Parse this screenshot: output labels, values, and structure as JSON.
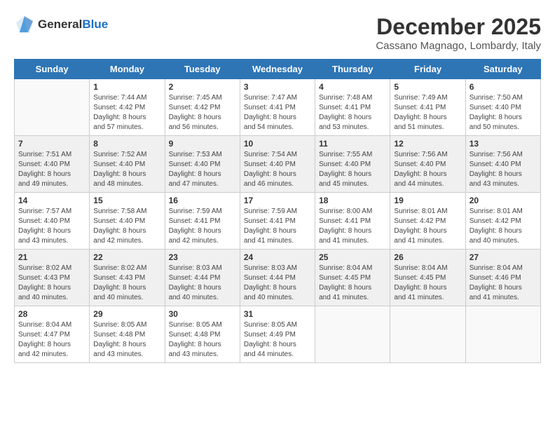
{
  "logo": {
    "general": "General",
    "blue": "Blue"
  },
  "title": "December 2025",
  "location": "Cassano Magnago, Lombardy, Italy",
  "headers": [
    "Sunday",
    "Monday",
    "Tuesday",
    "Wednesday",
    "Thursday",
    "Friday",
    "Saturday"
  ],
  "weeks": [
    [
      {
        "day": "",
        "info": ""
      },
      {
        "day": "1",
        "info": "Sunrise: 7:44 AM\nSunset: 4:42 PM\nDaylight: 8 hours\nand 57 minutes."
      },
      {
        "day": "2",
        "info": "Sunrise: 7:45 AM\nSunset: 4:42 PM\nDaylight: 8 hours\nand 56 minutes."
      },
      {
        "day": "3",
        "info": "Sunrise: 7:47 AM\nSunset: 4:41 PM\nDaylight: 8 hours\nand 54 minutes."
      },
      {
        "day": "4",
        "info": "Sunrise: 7:48 AM\nSunset: 4:41 PM\nDaylight: 8 hours\nand 53 minutes."
      },
      {
        "day": "5",
        "info": "Sunrise: 7:49 AM\nSunset: 4:41 PM\nDaylight: 8 hours\nand 51 minutes."
      },
      {
        "day": "6",
        "info": "Sunrise: 7:50 AM\nSunset: 4:40 PM\nDaylight: 8 hours\nand 50 minutes."
      }
    ],
    [
      {
        "day": "7",
        "info": "Sunrise: 7:51 AM\nSunset: 4:40 PM\nDaylight: 8 hours\nand 49 minutes."
      },
      {
        "day": "8",
        "info": "Sunrise: 7:52 AM\nSunset: 4:40 PM\nDaylight: 8 hours\nand 48 minutes."
      },
      {
        "day": "9",
        "info": "Sunrise: 7:53 AM\nSunset: 4:40 PM\nDaylight: 8 hours\nand 47 minutes."
      },
      {
        "day": "10",
        "info": "Sunrise: 7:54 AM\nSunset: 4:40 PM\nDaylight: 8 hours\nand 46 minutes."
      },
      {
        "day": "11",
        "info": "Sunrise: 7:55 AM\nSunset: 4:40 PM\nDaylight: 8 hours\nand 45 minutes."
      },
      {
        "day": "12",
        "info": "Sunrise: 7:56 AM\nSunset: 4:40 PM\nDaylight: 8 hours\nand 44 minutes."
      },
      {
        "day": "13",
        "info": "Sunrise: 7:56 AM\nSunset: 4:40 PM\nDaylight: 8 hours\nand 43 minutes."
      }
    ],
    [
      {
        "day": "14",
        "info": "Sunrise: 7:57 AM\nSunset: 4:40 PM\nDaylight: 8 hours\nand 43 minutes."
      },
      {
        "day": "15",
        "info": "Sunrise: 7:58 AM\nSunset: 4:40 PM\nDaylight: 8 hours\nand 42 minutes."
      },
      {
        "day": "16",
        "info": "Sunrise: 7:59 AM\nSunset: 4:41 PM\nDaylight: 8 hours\nand 42 minutes."
      },
      {
        "day": "17",
        "info": "Sunrise: 7:59 AM\nSunset: 4:41 PM\nDaylight: 8 hours\nand 41 minutes."
      },
      {
        "day": "18",
        "info": "Sunrise: 8:00 AM\nSunset: 4:41 PM\nDaylight: 8 hours\nand 41 minutes."
      },
      {
        "day": "19",
        "info": "Sunrise: 8:01 AM\nSunset: 4:42 PM\nDaylight: 8 hours\nand 41 minutes."
      },
      {
        "day": "20",
        "info": "Sunrise: 8:01 AM\nSunset: 4:42 PM\nDaylight: 8 hours\nand 40 minutes."
      }
    ],
    [
      {
        "day": "21",
        "info": "Sunrise: 8:02 AM\nSunset: 4:43 PM\nDaylight: 8 hours\nand 40 minutes."
      },
      {
        "day": "22",
        "info": "Sunrise: 8:02 AM\nSunset: 4:43 PM\nDaylight: 8 hours\nand 40 minutes."
      },
      {
        "day": "23",
        "info": "Sunrise: 8:03 AM\nSunset: 4:44 PM\nDaylight: 8 hours\nand 40 minutes."
      },
      {
        "day": "24",
        "info": "Sunrise: 8:03 AM\nSunset: 4:44 PM\nDaylight: 8 hours\nand 40 minutes."
      },
      {
        "day": "25",
        "info": "Sunrise: 8:04 AM\nSunset: 4:45 PM\nDaylight: 8 hours\nand 41 minutes."
      },
      {
        "day": "26",
        "info": "Sunrise: 8:04 AM\nSunset: 4:45 PM\nDaylight: 8 hours\nand 41 minutes."
      },
      {
        "day": "27",
        "info": "Sunrise: 8:04 AM\nSunset: 4:46 PM\nDaylight: 8 hours\nand 41 minutes."
      }
    ],
    [
      {
        "day": "28",
        "info": "Sunrise: 8:04 AM\nSunset: 4:47 PM\nDaylight: 8 hours\nand 42 minutes."
      },
      {
        "day": "29",
        "info": "Sunrise: 8:05 AM\nSunset: 4:48 PM\nDaylight: 8 hours\nand 43 minutes."
      },
      {
        "day": "30",
        "info": "Sunrise: 8:05 AM\nSunset: 4:48 PM\nDaylight: 8 hours\nand 43 minutes."
      },
      {
        "day": "31",
        "info": "Sunrise: 8:05 AM\nSunset: 4:49 PM\nDaylight: 8 hours\nand 44 minutes."
      },
      {
        "day": "",
        "info": ""
      },
      {
        "day": "",
        "info": ""
      },
      {
        "day": "",
        "info": ""
      }
    ]
  ]
}
